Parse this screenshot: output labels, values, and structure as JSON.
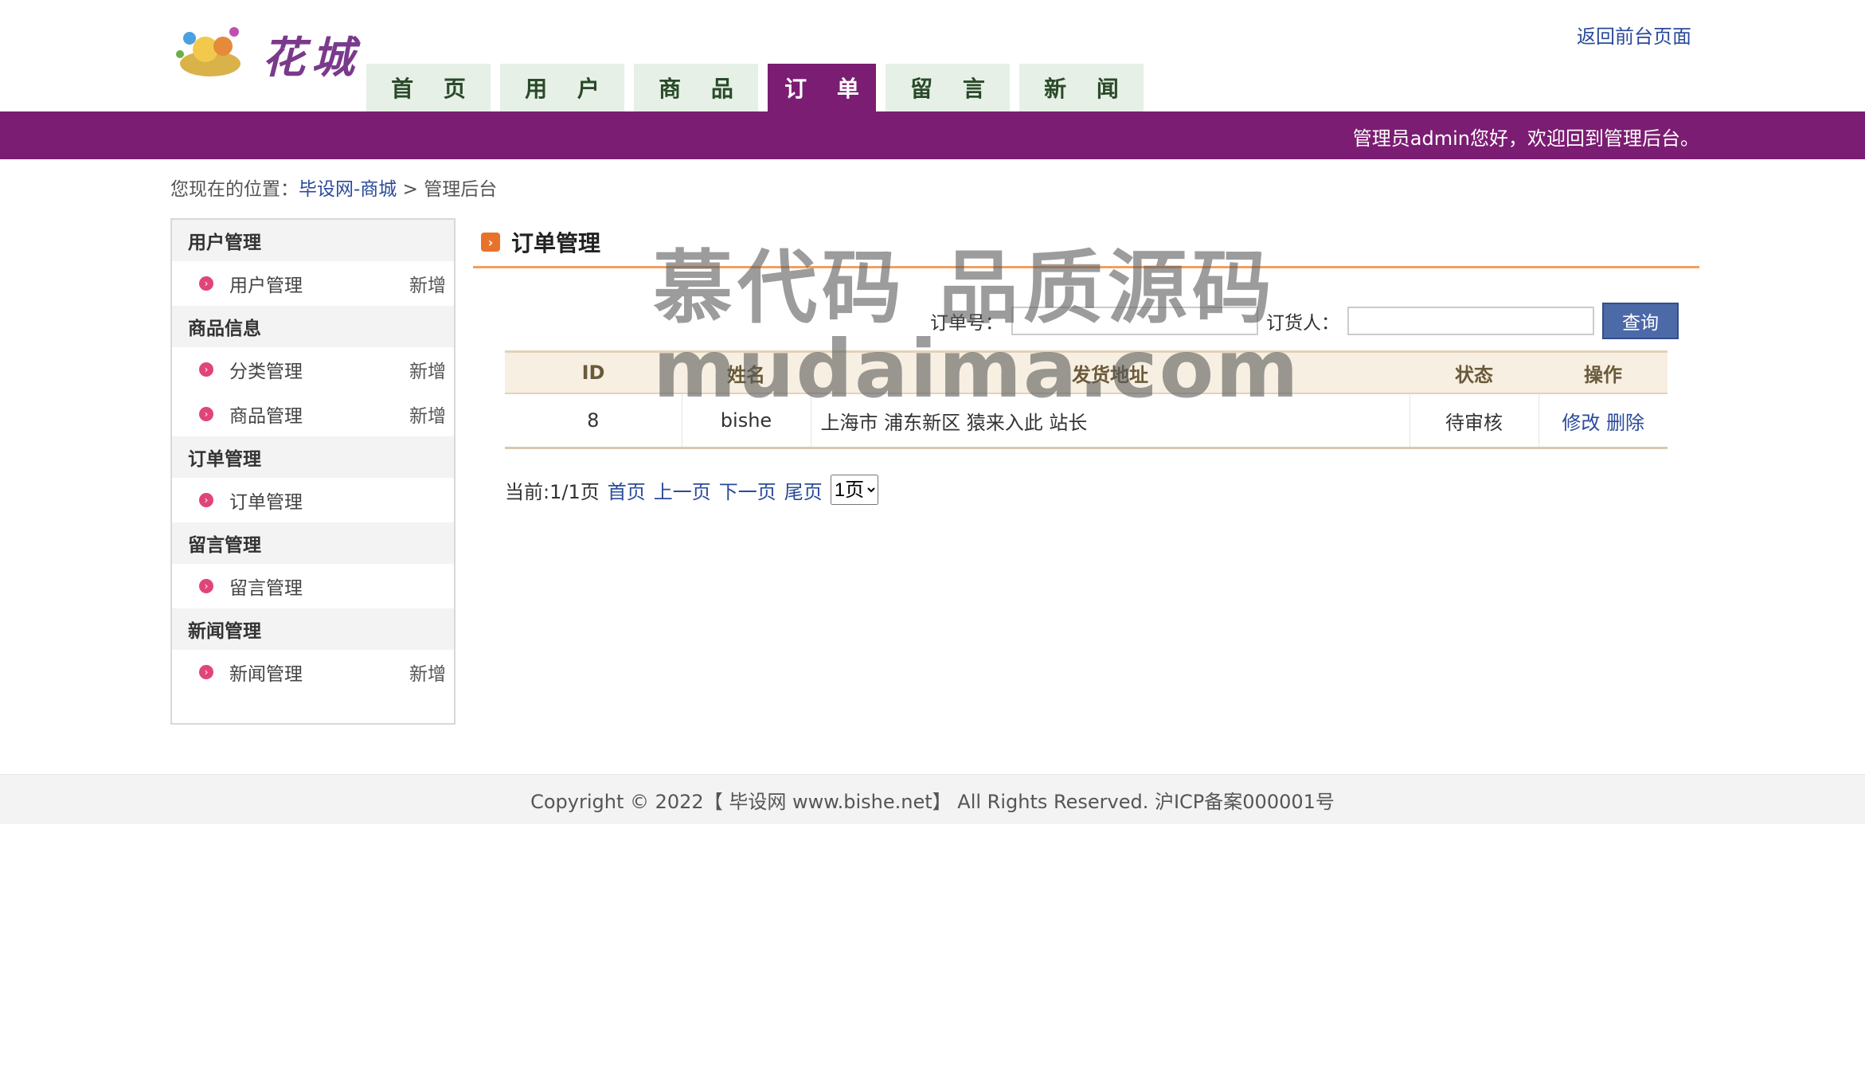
{
  "header": {
    "logo_text": "花城",
    "back_link": "返回前台页面",
    "nav": [
      {
        "label": "首 页",
        "active": false
      },
      {
        "label": "用 户",
        "active": false
      },
      {
        "label": "商 品",
        "active": false
      },
      {
        "label": "订 单",
        "active": true
      },
      {
        "label": "留 言",
        "active": false
      },
      {
        "label": "新 闻",
        "active": false
      }
    ],
    "welcome": "管理员admin您好，欢迎回到管理后台。",
    "band_color": "#7b1d72"
  },
  "breadcrumb": {
    "prefix": "您现在的位置：",
    "link": "毕设网-商城",
    "sep": ">",
    "current": "管理后台"
  },
  "sidebar": {
    "groups": [
      {
        "title": "用户管理",
        "items": [
          {
            "label": "用户管理",
            "add": "新增"
          }
        ]
      },
      {
        "title": "商品信息",
        "items": [
          {
            "label": "分类管理",
            "add": "新增"
          },
          {
            "label": "商品管理",
            "add": "新增"
          }
        ]
      },
      {
        "title": "订单管理",
        "items": [
          {
            "label": "订单管理",
            "add": ""
          }
        ]
      },
      {
        "title": "留言管理",
        "items": [
          {
            "label": "留言管理",
            "add": ""
          }
        ]
      },
      {
        "title": "新闻管理",
        "items": [
          {
            "label": "新闻管理",
            "add": "新增"
          }
        ]
      }
    ]
  },
  "main": {
    "title": "订单管理",
    "search": {
      "order_no_label": "订单号：",
      "order_no_value": "",
      "customer_label": "订货人：",
      "customer_value": "",
      "button": "查询"
    },
    "table": {
      "headers": [
        "ID",
        "姓名",
        "发货地址",
        "状态",
        "操作"
      ],
      "rows": [
        {
          "id": "8",
          "name": "bishe",
          "address": "上海市 浦东新区 猿来入此 站长",
          "status": "待审核",
          "edit": "修改",
          "delete": "删除"
        }
      ]
    },
    "pager": {
      "current": "当前:1/1页",
      "first": "首页",
      "prev": "上一页",
      "next": "下一页",
      "last": "尾页",
      "select_value": "1页"
    }
  },
  "footer": {
    "text": "Copyright © 2022【 毕设网 www.bishe.net】 All Rights Reserved. 沪ICP备案000001号"
  },
  "watermark": {
    "line1": "慕代码 品质源码",
    "line2": "mudaima.com"
  }
}
